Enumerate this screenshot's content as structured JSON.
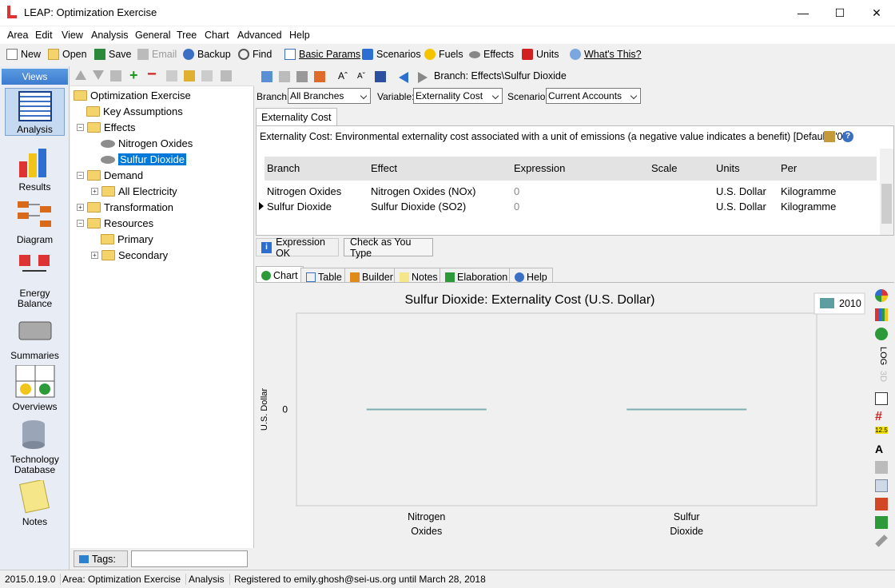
{
  "window": {
    "title": "LEAP: Optimization Exercise",
    "minimize": "—",
    "maximize": "☐",
    "close": "✕"
  },
  "menu": [
    "Area",
    "Edit",
    "View",
    "Analysis",
    "General",
    "Tree",
    "Chart",
    "Advanced",
    "Help"
  ],
  "toolbar": {
    "new": "New",
    "open": "Open",
    "save": "Save",
    "email": "Email",
    "backup": "Backup",
    "find": "Find",
    "basic_params": "Basic Params",
    "scenarios": "Scenarios",
    "fuels": "Fuels",
    "effects": "Effects",
    "units": "Units",
    "whats_this": "What's This?"
  },
  "views": {
    "header": "Views",
    "items": [
      "Analysis",
      "Results",
      "Diagram",
      "Energy Balance",
      "Summaries",
      "Overviews",
      "Technology Database",
      "Notes"
    ]
  },
  "tree": {
    "root": "Optimization Exercise",
    "nodes": [
      "Key Assumptions",
      "Effects",
      "Nitrogen Oxides",
      "Sulfur Dioxide",
      "Demand",
      "All Electricity",
      "Transformation",
      "Resources",
      "Primary",
      "Secondary"
    ],
    "tags_label": "Tags:",
    "tags_value": ""
  },
  "branch_path": "Branch: Effects\\Sulfur Dioxide",
  "filters": {
    "branch_label": "Branch:",
    "branch_value": "All Branches",
    "variable_label": "Variable:",
    "variable_value": "Externality Cost",
    "scenario_label": "Scenario:",
    "scenario_value": "Current Accounts"
  },
  "variable_tab": "Externality Cost",
  "description": "Externality Cost: Environmental externality cost associated with a unit of emissions (a negative value indicates a benefit) [Default=\"0\"]",
  "grid": {
    "headers": [
      "Branch",
      "Effect",
      "Expression",
      "Scale",
      "Units",
      "Per"
    ],
    "rows": [
      [
        "Nitrogen Oxides",
        "Nitrogen Oxides (NOx)",
        "0",
        "",
        "U.S. Dollar",
        "Kilogramme"
      ],
      [
        "Sulfur Dioxide",
        "Sulfur Dioxide (SO2)",
        "0",
        "",
        "U.S. Dollar",
        "Kilogramme"
      ]
    ]
  },
  "expr_status": {
    "ok": "Expression OK",
    "check": "Check as You Type"
  },
  "bottom_tabs": [
    "Chart",
    "Table",
    "Builder",
    "Notes",
    "Elaboration",
    "Help"
  ],
  "chart_side": {
    "log": "LOG",
    "threed": "3D",
    "decimals": "12.5"
  },
  "chart_data": {
    "type": "bar",
    "title": "Sulfur Dioxide: Externality Cost (U.S. Dollar)",
    "ylabel": "U.S. Dollar",
    "categories": [
      "Nitrogen Oxides",
      "Sulfur Dioxide"
    ],
    "series": [
      {
        "name": "2010",
        "values": [
          0,
          0
        ]
      }
    ],
    "yticks": [
      "0"
    ],
    "legend": "top-right",
    "series_color": "#5f9ea0"
  },
  "status": {
    "version": "2015.0.19.0",
    "area": "Area: Optimization Exercise",
    "view": "Analysis",
    "registration": "Registered to emily.ghosh@sei-us.org until March 28, 2018"
  }
}
